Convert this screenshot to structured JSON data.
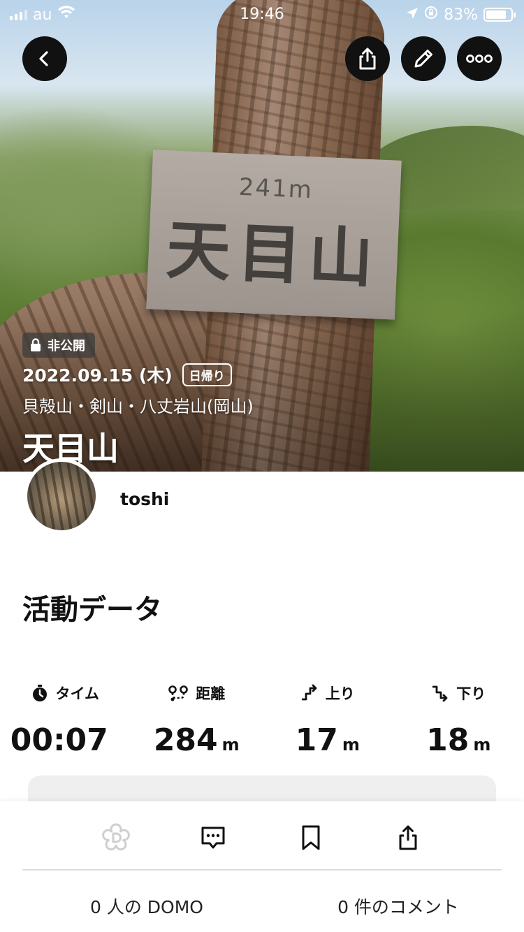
{
  "status_bar": {
    "carrier": "au",
    "time": "19:46",
    "battery": "83%",
    "battery_level": 0.83
  },
  "header": {
    "back_icon": "chevron-left-icon",
    "share_icon": "share-icon",
    "edit_icon": "pencil-icon",
    "more_icon": "more-icon"
  },
  "hero": {
    "visibility_badge": "非公開",
    "date": "2022.09.15 (木)",
    "trip_tag": "日帰り",
    "mountains": "貝殻山・剣山・八丈岩山(岡山)",
    "title": "天目山",
    "sign_top": "241m",
    "sign_main": "天目山"
  },
  "user": {
    "name": "toshi"
  },
  "activity": {
    "section_title": "活動データ",
    "stats": [
      {
        "label": "タイム",
        "value": "00:07",
        "unit": "",
        "icon": "stopwatch-icon"
      },
      {
        "label": "距離",
        "value": "284",
        "unit": "m",
        "icon": "route-icon"
      },
      {
        "label": "上り",
        "value": "17",
        "unit": "m",
        "icon": "ascent-icon"
      },
      {
        "label": "下り",
        "value": "18",
        "unit": "m",
        "icon": "descent-icon"
      }
    ]
  },
  "bottom_bar": {
    "domo_count": "0 人の DOMO",
    "comment_count": "0 件のコメント",
    "colors": {
      "domo_disabled": "#cfcfcf",
      "icon": "#111111"
    }
  }
}
